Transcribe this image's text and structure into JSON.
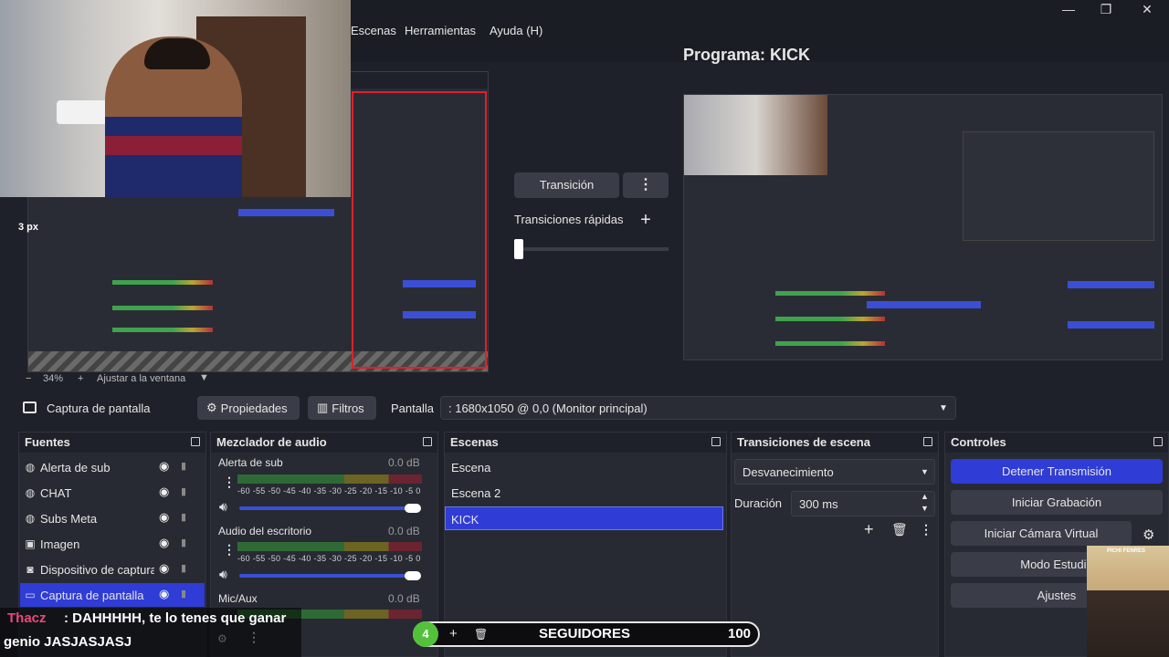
{
  "menu": {
    "items": [
      "Escenas",
      "Herramientas",
      "Ayuda (H)"
    ]
  },
  "window_controls": {
    "minimize": "—",
    "restore": "❐",
    "close": "✕"
  },
  "program": {
    "title": "Programa: KICK"
  },
  "preview": {
    "px_label": "3 px"
  },
  "transition": {
    "button_label": "Transición",
    "quick_label": "Transiciones rápidas",
    "add_label": "+",
    "menu_label": "⋮",
    "tbar_position": 0.0
  },
  "zoom": {
    "minus": "−",
    "value": "34%",
    "plus": "+",
    "fit_label": "Ajustar a la ventana"
  },
  "source_toolbar": {
    "source_name": "Captura de pantalla",
    "properties_label": "Propiedades",
    "filters_label": "Filtros",
    "screen_label": "Pantalla",
    "screen_value": ": 1680x1050 @ 0,0 (Monitor principal)"
  },
  "sources": {
    "title": "Fuentes",
    "items": [
      {
        "label": "Alerta de sub",
        "icon": "globe-icon"
      },
      {
        "label": "CHAT",
        "icon": "globe-icon"
      },
      {
        "label": "Subs Meta",
        "icon": "globe-icon"
      },
      {
        "label": "Imagen",
        "icon": "image-icon"
      },
      {
        "label": "Dispositivo de captura",
        "icon": "camera-icon"
      },
      {
        "label": "Captura de pantalla",
        "icon": "monitor-icon"
      }
    ]
  },
  "mixer": {
    "title": "Mezclador de audio",
    "ticks": "-60 -55 -50 -45 -40 -35 -30 -25 -20 -15 -10  -5  0",
    "channels": [
      {
        "name": "Alerta de sub",
        "db": "0.0 dB",
        "level": 0.0
      },
      {
        "name": "Audio del escritorio",
        "db": "0.0 dB",
        "level": 0.0
      },
      {
        "name": "Mic/Aux",
        "db": "0.0 dB",
        "level": 0.0
      }
    ]
  },
  "scenes": {
    "title": "Escenas",
    "items": [
      "Escena",
      "Escena 2",
      "KICK"
    ],
    "selected": "KICK"
  },
  "scene_transitions": {
    "title": "Transiciones de escena",
    "selected": "Desvanecimiento",
    "duration_label": "Duración",
    "duration_value": "300 ms"
  },
  "controls": {
    "title": "Controles",
    "buttons": [
      {
        "label": "Detener Transmisión",
        "active": true
      },
      {
        "label": "Iniciar Grabación",
        "active": false
      },
      {
        "label": "Iniciar Cámara Virtual",
        "active": false
      },
      {
        "label": "Modo Estudio",
        "active": true
      },
      {
        "label": "Ajustes",
        "active": false
      }
    ]
  },
  "chat_overlay": {
    "name": "Thacz",
    "message": ": DAHHHHH, te lo tenes que ganar",
    "message2": "genio JASJASJASJ"
  },
  "followers_overlay": {
    "badge": "4",
    "label": "SEGUIDORES",
    "count": "100"
  },
  "cam_overlay": {
    "label": "PICHI FENRES"
  },
  "colors": {
    "accent": "#2f3cd6",
    "panel": "#272a33",
    "background": "#1f212a",
    "tally_red": "#e0202a"
  }
}
